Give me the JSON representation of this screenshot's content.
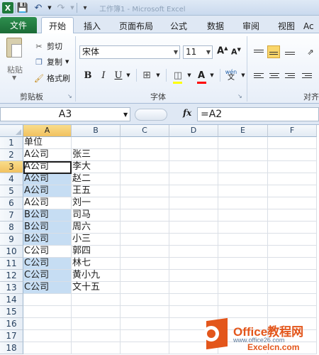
{
  "title_bar": {
    "logo": "X",
    "title": "工作簿1 - Microsoft Excel",
    "icons": [
      "excel-logo-icon",
      "save-icon",
      "undo-icon",
      "redo-icon",
      "customize-qat-icon"
    ]
  },
  "tabs": {
    "file": "文件",
    "items": [
      "开始",
      "插入",
      "页面布局",
      "公式",
      "数据",
      "审阅",
      "视图",
      "Ac"
    ],
    "active": "开始"
  },
  "ribbon": {
    "clipboard": {
      "paste": "粘贴",
      "cut": "剪切",
      "copy": "复制",
      "format_painter": "格式刷",
      "group_label": "剪贴板"
    },
    "font": {
      "font_name": "宋体",
      "font_size": "11",
      "grow": "A",
      "shrink": "A",
      "bold": "B",
      "italic": "I",
      "underline": "U",
      "font_color_letter": "A",
      "wen": "wén",
      "group_label": "字体",
      "fill_color": "#ffff00",
      "font_color": "#ff0000"
    },
    "alignment": {
      "group_label": "对齐"
    }
  },
  "formula_bar": {
    "name_box": "A3",
    "fx": "fx",
    "formula": "=A2"
  },
  "sheet": {
    "columns": [
      "A",
      "B",
      "C",
      "D",
      "E",
      "F"
    ],
    "selected_column": "A",
    "active_cell": "A3",
    "highlight_color": "#c6ddf3",
    "rows": [
      {
        "n": "1",
        "a": "单位",
        "b": "",
        "hl": false
      },
      {
        "n": "2",
        "a": "A公司",
        "b": "张三",
        "hl": false
      },
      {
        "n": "3",
        "a": "A公司",
        "b": "李大",
        "hl": false
      },
      {
        "n": "4",
        "a": "A公司",
        "b": "赵二",
        "hl": true
      },
      {
        "n": "5",
        "a": "A公司",
        "b": "王五",
        "hl": true
      },
      {
        "n": "6",
        "a": "A公司",
        "b": "刘一",
        "hl": false
      },
      {
        "n": "7",
        "a": "B公司",
        "b": "司马",
        "hl": true
      },
      {
        "n": "8",
        "a": "B公司",
        "b": "周六",
        "hl": true
      },
      {
        "n": "9",
        "a": "B公司",
        "b": "小三",
        "hl": true
      },
      {
        "n": "10",
        "a": "C公司",
        "b": "郭四",
        "hl": false
      },
      {
        "n": "11",
        "a": "C公司",
        "b": "林七",
        "hl": true
      },
      {
        "n": "12",
        "a": "C公司",
        "b": "黄小九",
        "hl": true
      },
      {
        "n": "13",
        "a": "C公司",
        "b": "文十五",
        "hl": true
      },
      {
        "n": "14",
        "a": "",
        "b": "",
        "hl": false
      },
      {
        "n": "15",
        "a": "",
        "b": "",
        "hl": false
      },
      {
        "n": "16",
        "a": "",
        "b": "",
        "hl": false
      },
      {
        "n": "17",
        "a": "",
        "b": "",
        "hl": false
      },
      {
        "n": "18",
        "a": "",
        "b": "",
        "hl": false
      }
    ]
  },
  "watermark": {
    "title": "Office教程网",
    "sub1": "www.office26.com",
    "sub2": "Excelcn.com"
  }
}
